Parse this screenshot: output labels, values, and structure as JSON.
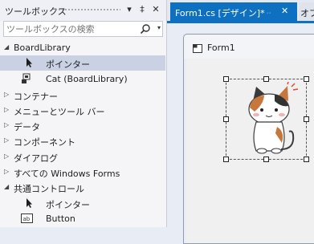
{
  "toolbox": {
    "title": "ツールボックス",
    "search_placeholder": "ツールボックスの検索",
    "header_buttons": [
      "▾",
      "‡",
      "✕"
    ],
    "groups": [
      {
        "label": "BoardLibrary",
        "expanded": true
      },
      {
        "label": "ポインター",
        "item": true,
        "icon": "pointer-icon",
        "selected": true
      },
      {
        "label": "Cat (BoardLibrary)",
        "item": true,
        "icon": "component-icon"
      },
      {
        "label": "コンテナー",
        "expanded": false
      },
      {
        "label": "メニューとツール バー",
        "expanded": false
      },
      {
        "label": "データ",
        "expanded": false
      },
      {
        "label": "コンポーネント",
        "expanded": false
      },
      {
        "label": "ダイアログ",
        "expanded": false
      },
      {
        "label": "すべての Windows Forms",
        "expanded": false
      },
      {
        "label": "共通コントロール",
        "expanded": true
      },
      {
        "label": "ポインター",
        "item": true,
        "icon": "pointer-icon"
      },
      {
        "label": "Button",
        "item": true,
        "icon": "button-icon"
      }
    ]
  },
  "designer": {
    "active_tab": {
      "label": "Form1.cs [デザイン]*",
      "pin": "ᆢ",
      "close": "✕"
    },
    "next_tab": {
      "label": "オブ"
    },
    "form": {
      "title": "Form1"
    }
  },
  "colors": {
    "accent": "#0e70c0",
    "selection": "#c9d1e3"
  }
}
